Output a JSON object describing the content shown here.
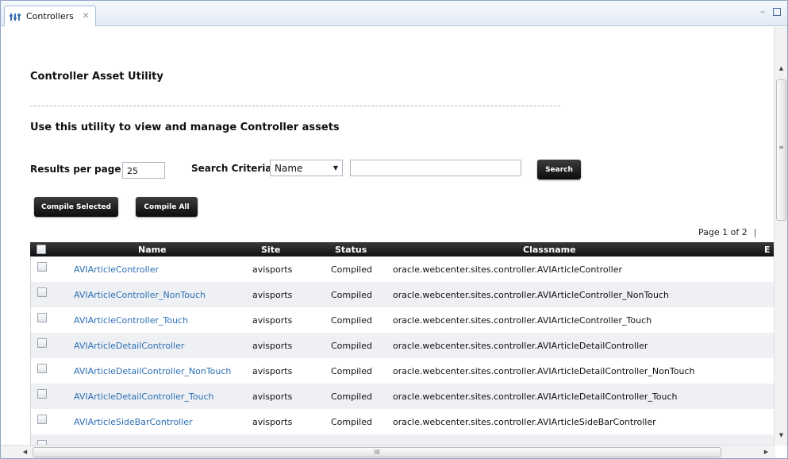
{
  "tab": {
    "label": "Controllers",
    "close_glyph": "✕",
    "icon": "controllers-icon"
  },
  "window_controls": {
    "minimize": "▭",
    "maximize": "□"
  },
  "page": {
    "title": "Controller Asset Utility",
    "subtitle": "Use this utility to view and manage Controller assets"
  },
  "form": {
    "results_label": "Results per page",
    "results_value": "25",
    "criteria_label": "Search Criteria",
    "criteria_selected": "Name",
    "search_value": "",
    "search_button": "Search",
    "compile_selected_button": "Compile Selected",
    "compile_all_button": "Compile All"
  },
  "pager": {
    "text": "Page 1 of 2",
    "separator": "|"
  },
  "table": {
    "headers": {
      "name": "Name",
      "site": "Site",
      "status": "Status",
      "classname": "Classname",
      "extra": "E"
    },
    "rows": [
      {
        "name": "AVIArticleController",
        "site": "avisports",
        "status": "Compiled",
        "classname": "oracle.webcenter.sites.controller.AVIArticleController"
      },
      {
        "name": "AVIArticleController_NonTouch",
        "site": "avisports",
        "status": "Compiled",
        "classname": "oracle.webcenter.sites.controller.AVIArticleController_NonTouch"
      },
      {
        "name": "AVIArticleController_Touch",
        "site": "avisports",
        "status": "Compiled",
        "classname": "oracle.webcenter.sites.controller.AVIArticleController_Touch"
      },
      {
        "name": "AVIArticleDetailController",
        "site": "avisports",
        "status": "Compiled",
        "classname": "oracle.webcenter.sites.controller.AVIArticleDetailController"
      },
      {
        "name": "AVIArticleDetailController_NonTouch",
        "site": "avisports",
        "status": "Compiled",
        "classname": "oracle.webcenter.sites.controller.AVIArticleDetailController_NonTouch"
      },
      {
        "name": "AVIArticleDetailController_Touch",
        "site": "avisports",
        "status": "Compiled",
        "classname": "oracle.webcenter.sites.controller.AVIArticleDetailController_Touch"
      },
      {
        "name": "AVIArticleSideBarController",
        "site": "avisports",
        "status": "Compiled",
        "classname": "oracle.webcenter.sites.controller.AVIArticleSideBarController"
      }
    ]
  },
  "scrollbar": {
    "grip": "III",
    "vgrip": "≡"
  },
  "colors": {
    "link": "#2d6fb5",
    "header_bg": "#1a1a1a",
    "row_alt": "#eef0f3"
  }
}
